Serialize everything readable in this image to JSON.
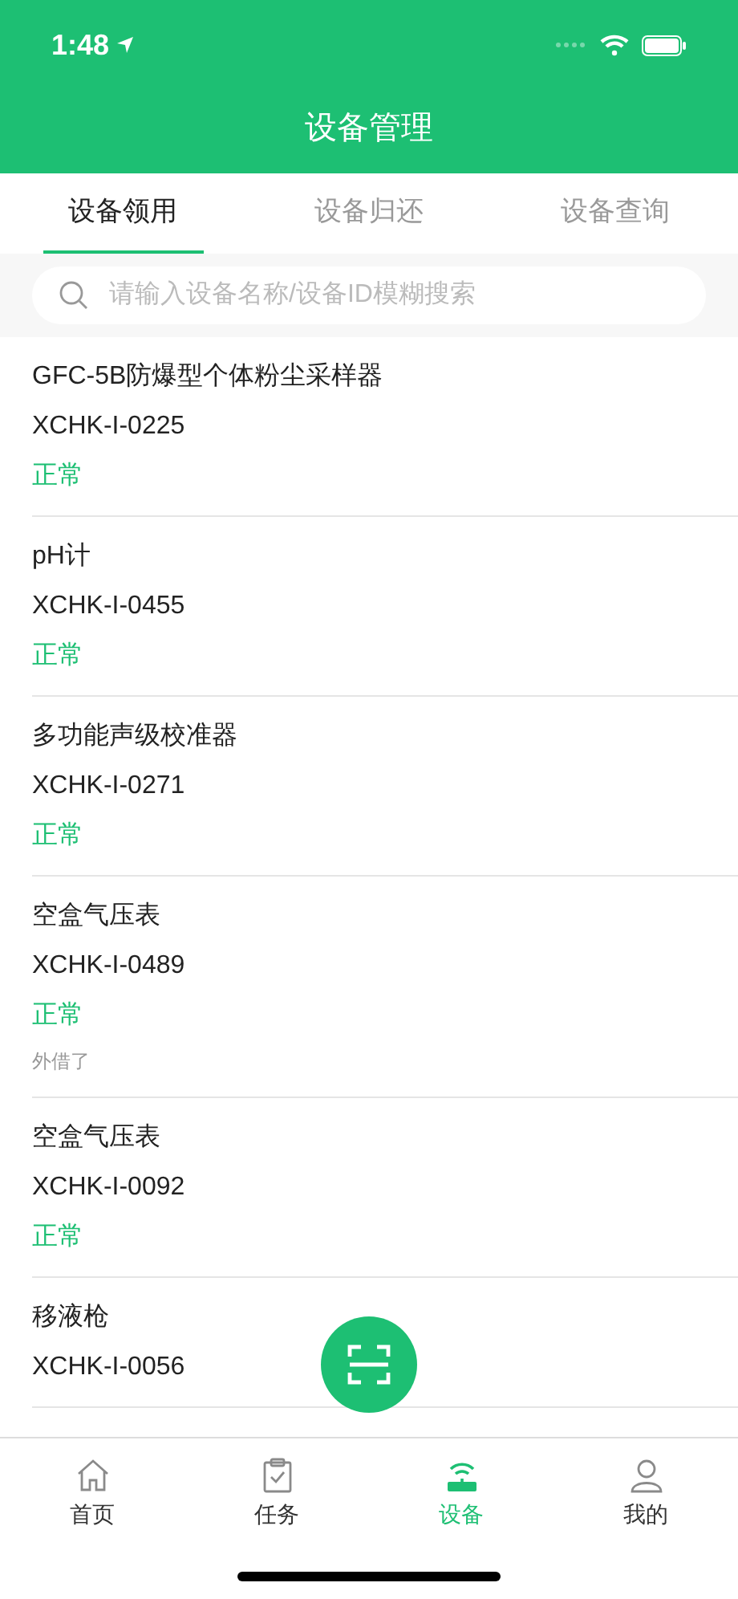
{
  "status_bar": {
    "time": "1:48"
  },
  "header": {
    "title": "设备管理"
  },
  "tabs": [
    {
      "label": "设备领用",
      "selected": true
    },
    {
      "label": "设备归还",
      "selected": false
    },
    {
      "label": "设备查询",
      "selected": false
    }
  ],
  "search": {
    "placeholder": "请输入设备名称/设备ID模糊搜索"
  },
  "devices": [
    {
      "name": "GFC-5B防爆型个体粉尘采样器",
      "id": "XCHK-I-0225",
      "status": "正常"
    },
    {
      "name": "pH计",
      "id": "XCHK-I-0455",
      "status": "正常"
    },
    {
      "name": "多功能声级校准器",
      "id": "XCHK-I-0271",
      "status": "正常"
    },
    {
      "name": "空盒气压表",
      "id": "XCHK-I-0489",
      "status": "正常",
      "note": "外借了"
    },
    {
      "name": "空盒气压表",
      "id": "XCHK-I-0092",
      "status": "正常"
    },
    {
      "name": "移液枪",
      "id": "XCHK-I-0056"
    }
  ],
  "tab_bar": [
    {
      "label": "首页",
      "kind": "home",
      "selected": false
    },
    {
      "label": "任务",
      "kind": "task",
      "selected": false
    },
    {
      "label": "设备",
      "kind": "device",
      "selected": true
    },
    {
      "label": "我的",
      "kind": "me",
      "selected": false
    }
  ]
}
